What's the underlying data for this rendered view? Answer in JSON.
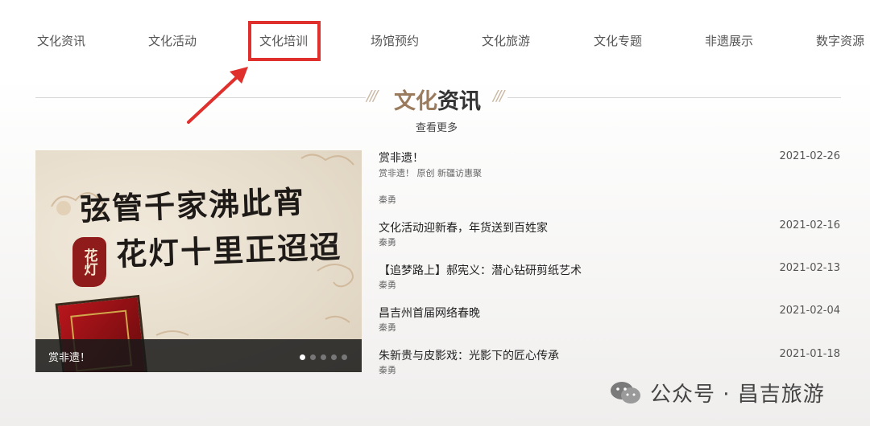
{
  "nav": {
    "items": [
      "文化资讯",
      "文化活动",
      "文化培训",
      "场馆预约",
      "文化旅游",
      "文化专题",
      "非遗展示",
      "数字资源"
    ]
  },
  "section": {
    "title_part1": "文化",
    "title_part2": "资讯",
    "more_label": "查看更多"
  },
  "banner": {
    "line1": "弦管千家沸此宵",
    "line2": "花灯十里正迢迢",
    "seal_text": "花灯",
    "caption": "赏非遗！",
    "slide_count": 5,
    "active_slide": 1
  },
  "news": [
    {
      "title": "赏非遗！",
      "subtitle": "赏非遗！ 原创 新疆访惠聚",
      "author": "秦勇",
      "date": "2021-02-26"
    },
    {
      "title": "文化活动迎新春，年货送到百姓家",
      "author": "秦勇",
      "date": "2021-02-16"
    },
    {
      "title": "【追梦路上】郝宪义：潜心钻研剪纸艺术",
      "author": "秦勇",
      "date": "2021-02-13"
    },
    {
      "title": "昌吉州首届网络春晚",
      "author": "秦勇",
      "date": "2021-02-04"
    },
    {
      "title": "朱新贵与皮影戏：光影下的匠心传承",
      "author": "秦勇",
      "date": "2021-01-18"
    }
  ],
  "watermark": {
    "text": "公众号 · 昌吉旅游",
    "icon": "wechat-icon"
  },
  "colors": {
    "highlight": "#e0302d",
    "title_accent": "#9b7b5e",
    "seal": "#8f1c1a"
  }
}
